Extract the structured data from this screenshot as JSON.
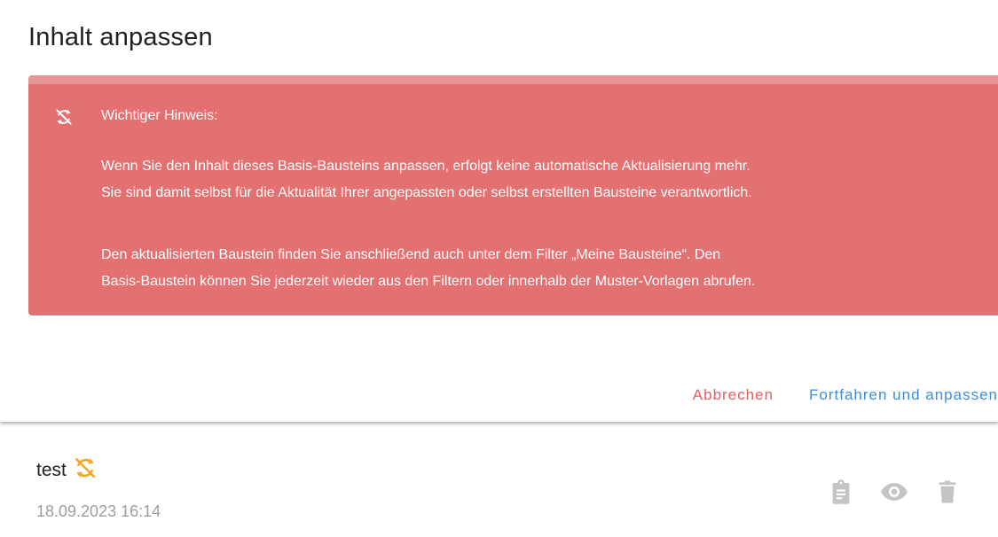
{
  "dialog": {
    "title": "Inhalt anpassen",
    "alert": {
      "icon": "sync-disabled-icon",
      "heading": "Wichtiger Hinweis:",
      "paragraph1_line1": "Wenn Sie den Inhalt dieses Basis-Bausteins anpassen, erfolgt keine automatische Aktualisierung mehr.",
      "paragraph1_line2": "Sie sind damit selbst für die Aktualität Ihrer angepassten oder selbst erstellten Bausteine verantwortlich.",
      "paragraph2_line1": "Den aktualisierten Baustein finden Sie anschließend auch unter dem Filter „Meine Bausteine“. Den",
      "paragraph2_line2": "Basis-Baustein können Sie jederzeit wieder aus den Filtern oder innerhalb der Muster-Vorlagen abrufen."
    },
    "actions": {
      "cancel_label": "Abbrechen",
      "continue_label": "Fortfahren und anpassen"
    }
  },
  "item": {
    "title": "test",
    "status_icon": "sync-disabled-icon",
    "date": "18.09.2023 16:14",
    "action_icons": [
      "clipboard-icon",
      "eye-icon",
      "trash-icon"
    ]
  },
  "colors": {
    "alert_bg": "#e47171",
    "alert_top": "#e99494",
    "cancel": "#e0605f",
    "continue": "#3d8ed8",
    "status_icon": "#f5a623",
    "action_icon": "#c4c4c4"
  }
}
